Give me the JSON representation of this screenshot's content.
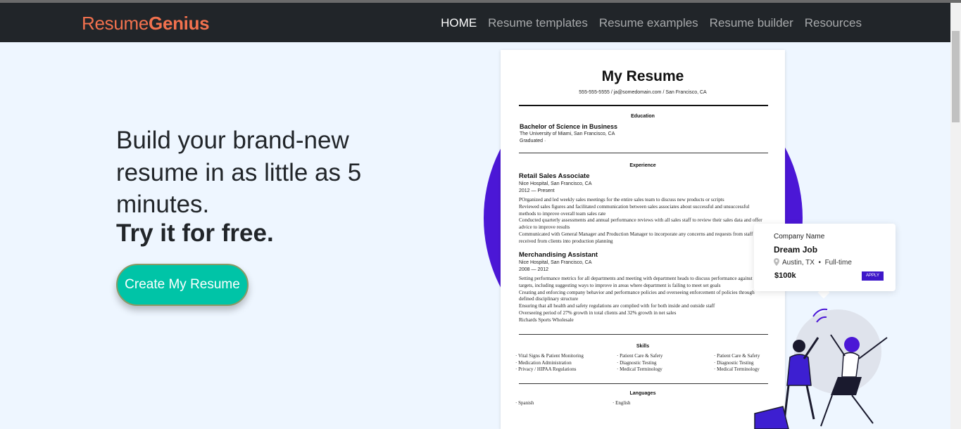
{
  "brand": {
    "logo_light": "Resume",
    "logo_bold": "Genius",
    "color": "#f2714e"
  },
  "nav": {
    "items": [
      "HOME",
      "Resume templates",
      "Resume examples",
      "Resume builder",
      "Resources"
    ]
  },
  "hero": {
    "headline": "Build your brand-new resume in as little as 5 minutes.",
    "strong": "Try it for free.",
    "cta": "Create My Resume",
    "cta_color": "#00c4a7"
  },
  "resume": {
    "title": "My Resume",
    "contact": "555-555-5555 / ja@somedomain.com / San Francisco, CA",
    "education_heading": "Education",
    "degree": "Bachelor of Science in Business",
    "school": "The University of Miami, San Francisco, CA",
    "graduated": "Graduated ·",
    "experience_heading": "Experience",
    "job1_title": "Retail Sales Associate",
    "job1_company": "Nice Hospital, San Francisco, CA",
    "job1_dates": "2012 — Present",
    "job1_bullets": [
      "POrganized and led weekly sales meetings for the entire sales team to discuss new products or scripts",
      "Reviewed sales figures and facilitated communication between sales associates about successful and unsuccessful methods to improve overall team sales rate",
      "Conducted quarterly assessments and annual performance reviews with all sales staff to review their sales data and offer advice to improve results",
      "Communicated with General Manager and Production Manager to incorporate any concerns and requests from staff received from clients into production planning"
    ],
    "job2_title": "Merchandising Assistant",
    "job2_company": "Nice Hospital, San Francisco, CA",
    "job2_dates": "2008 — 2012",
    "job2_bullets": [
      "Setting performance metrics for all departments and meeting with department heads to discuss performance against targets, including suggesting ways to improve in areas where department is failing to meet set goals",
      "Creating and enforcing company behavior and performance policies and overseeing enforcement of policies through defined disciplinary structure",
      "Ensuring that all health and safety regulations are complied with for both inside and outside staff",
      "Overseeing period of 27% growth in total clients and 32% growth in net sales",
      "Richards Sports Wholesale"
    ],
    "skills_heading": "Skills",
    "skills_col1": [
      "Vital Signs & Patient Monitoring",
      "Medication Administration",
      "Privacy / HIPAA Regulations"
    ],
    "skills_col2": [
      "Patient Care & Safety",
      "Diagnostic Testing",
      "Medical Terminology"
    ],
    "skills_col3": [
      "Patient Care & Safety",
      "Diagnostic Testing",
      "Medical Terminology"
    ],
    "languages_heading": "Languages",
    "languages": [
      "Spanish",
      "English"
    ]
  },
  "job_card": {
    "company": "Company Name",
    "title": "Dream Job",
    "location": "Austin, TX",
    "type": "Full-time",
    "salary": "$100k",
    "apply": "APPLY"
  },
  "colors": {
    "navbar": "#212529",
    "background": "#eef6ff",
    "circle": "#4b17d6",
    "apply": "#3e17c9"
  }
}
